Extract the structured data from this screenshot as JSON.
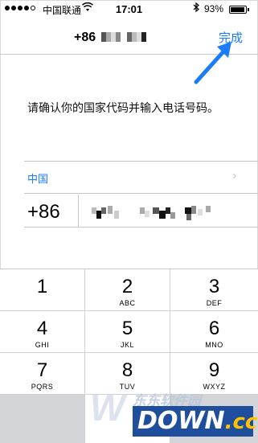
{
  "status_bar": {
    "carrier": "中国联通",
    "wifi_icon": "wifi-icon",
    "time": "17:01",
    "bluetooth_icon": "bluetooth-icon",
    "battery_percent": "93%",
    "battery_level": 0.93
  },
  "nav": {
    "title_prefix": "+86",
    "done_label": "完成"
  },
  "prompt": "请确认你的国家代码并输入电话号码。",
  "country": {
    "name": "中国",
    "chevron": "›"
  },
  "phone": {
    "code": "+86"
  },
  "keypad": {
    "keys": [
      {
        "num": "1",
        "letters": ""
      },
      {
        "num": "2",
        "letters": "ABC"
      },
      {
        "num": "3",
        "letters": "DEF"
      },
      {
        "num": "4",
        "letters": "GHI"
      },
      {
        "num": "5",
        "letters": "JKL"
      },
      {
        "num": "6",
        "letters": "MNO"
      },
      {
        "num": "7",
        "letters": "PQRS"
      },
      {
        "num": "8",
        "letters": "TUV"
      },
      {
        "num": "9",
        "letters": "WXYZ"
      }
    ]
  },
  "watermark": {
    "brand": "DOWN",
    "suffix": ".cc",
    "cn_text": "东东软件园"
  }
}
